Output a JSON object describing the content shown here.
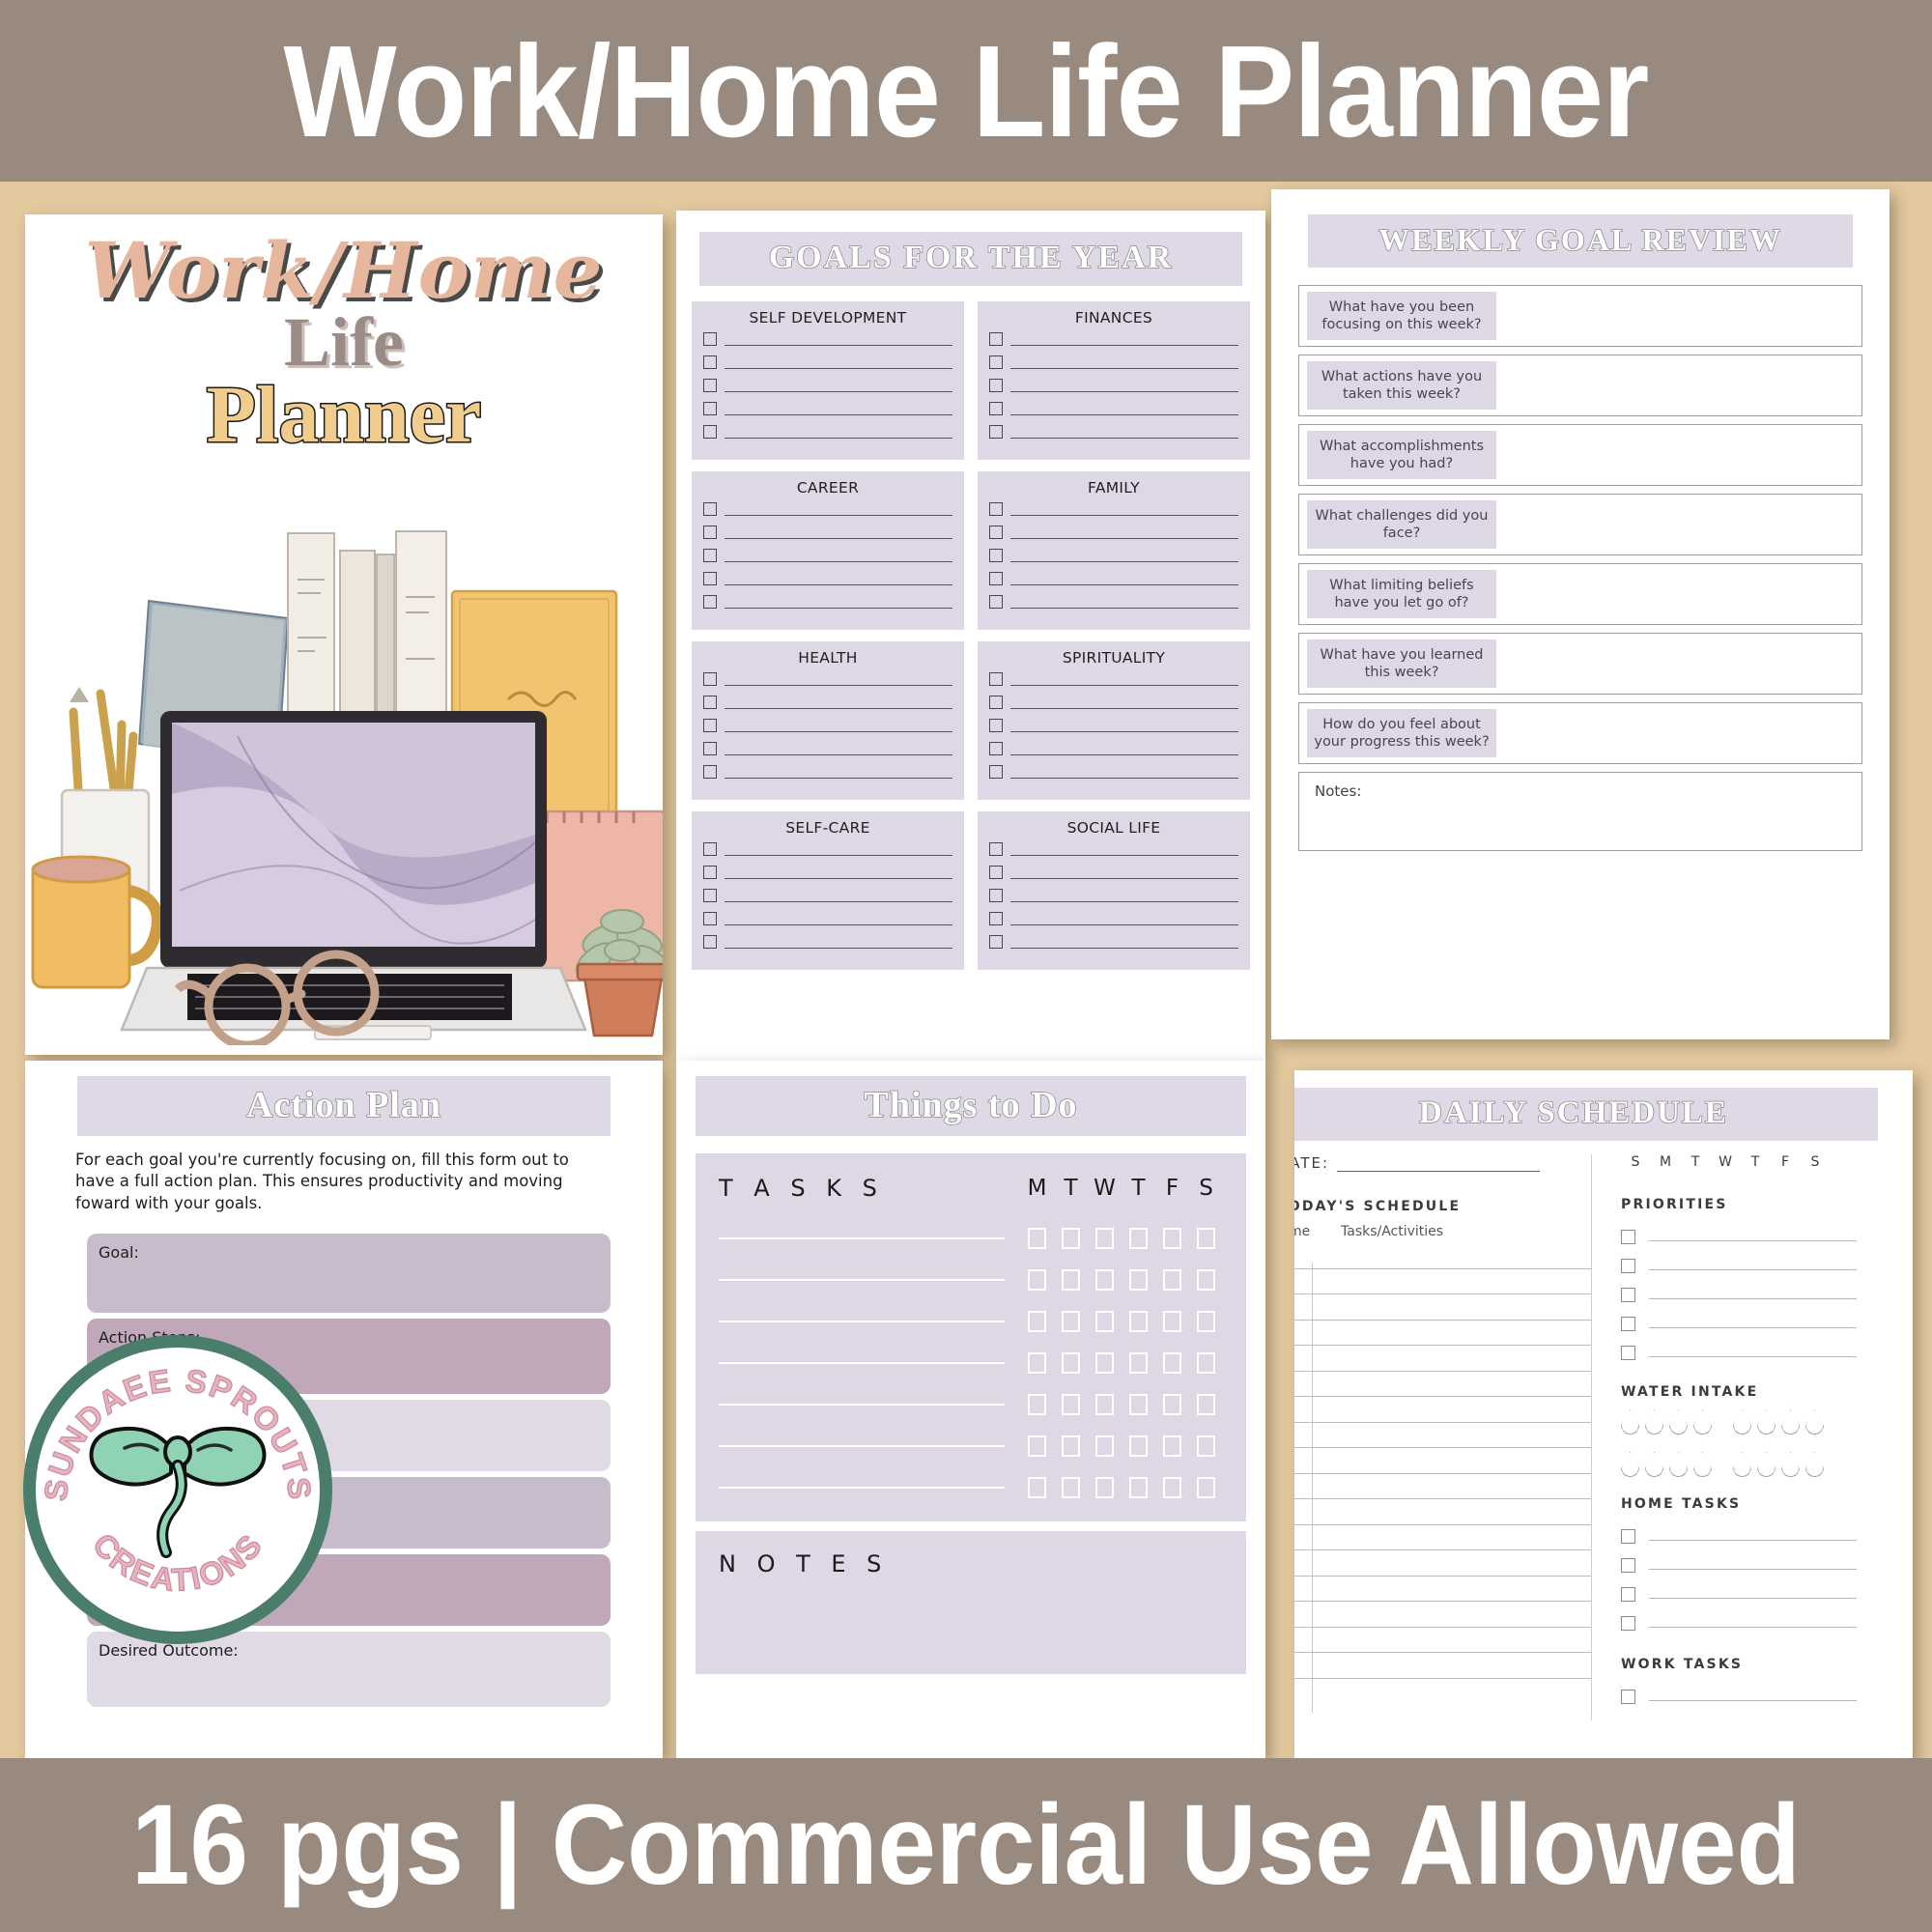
{
  "banners": {
    "top_title": "Work/Home Life Planner",
    "bottom_title": "16 pgs | Commercial Use Allowed"
  },
  "colors": {
    "banner_taupe": "#998a80",
    "inner_tan": "#e3c99e",
    "lavender_header": "#dfd8e6",
    "lavender_box": "#ded7e6",
    "logo_green": "#4b7d6b",
    "logo_pink": "#e8b3bf",
    "logo_mint": "#8fd3b4",
    "cover_peach": "#e6b79d",
    "cover_gold": "#f0cd8c",
    "cover_taupe": "#9a8b86"
  },
  "cover": {
    "line1": "Work/Home",
    "line2": "Life",
    "line3": "Planner",
    "illustration_name": "watercolor-desk-scene"
  },
  "goals_page": {
    "header": "GOALS FOR THE YEAR",
    "categories": [
      "SELF DEVELOPMENT",
      "FINANCES",
      "CAREER",
      "FAMILY",
      "HEALTH",
      "SPIRITUALITY",
      "SELF-CARE",
      "SOCIAL LIFE"
    ],
    "rows_per_category": 5
  },
  "weekly_page": {
    "header": "WEEKLY GOAL REVIEW",
    "questions": [
      "What have you been focusing on this week?",
      "What actions have you taken this week?",
      "What accomplishments have you had?",
      "What challenges did you face?",
      "What limiting beliefs have you let go of?",
      "What have you learned this week?",
      "How do you feel about your progress this week?"
    ],
    "notes_label": "Notes:"
  },
  "action_page": {
    "header": "Action Plan",
    "description": "For each goal you're currently focusing on, fill this form out to have a full action plan. This ensures productivity and moving foward with your goals.",
    "fields": [
      {
        "label": "Goal:",
        "shade": "#c6bccb",
        "height": 82
      },
      {
        "label": "Action Steps:",
        "shade": "#c0a8ba",
        "height": 78
      },
      {
        "label": "",
        "shade": "#e0d9e6",
        "height": 74
      },
      {
        "label": "",
        "shade": "#c6bccb",
        "height": 74
      },
      {
        "label": "",
        "shade": "#c0a8ba",
        "height": 74
      },
      {
        "label": "Desired Outcome:",
        "shade": "#e0d9e6",
        "height": 78
      }
    ]
  },
  "todo_page": {
    "header": "Things to Do",
    "tasks_label": "T A S K S",
    "days": [
      "M",
      "T",
      "W",
      "T",
      "F",
      "S"
    ],
    "task_rows": 7,
    "notes_label": "N O T E S"
  },
  "daily_page": {
    "header": "DAILY SCHEDULE",
    "date_label": "DATE:",
    "days_of_week": [
      "S",
      "M",
      "T",
      "W",
      "T",
      "F",
      "S"
    ],
    "schedule_section": "TODAY'S SCHEDULE",
    "col_time": "Time",
    "col_tasks": "Tasks/Activities",
    "schedule_lines": 17,
    "priorities_label": "PRIORITIES",
    "priorities_rows": 5,
    "water_label": "WATER INTAKE",
    "water_drops": 16,
    "home_tasks_label": "HOME TASKS",
    "home_tasks_rows": 4,
    "work_tasks_label": "WORK TASKS",
    "work_tasks_rows": 1
  },
  "logo": {
    "top_arc": "SUNDAEE SPROUTS",
    "bottom_arc": "CREATIONS",
    "emblem": "sprout-seedling-icon"
  }
}
